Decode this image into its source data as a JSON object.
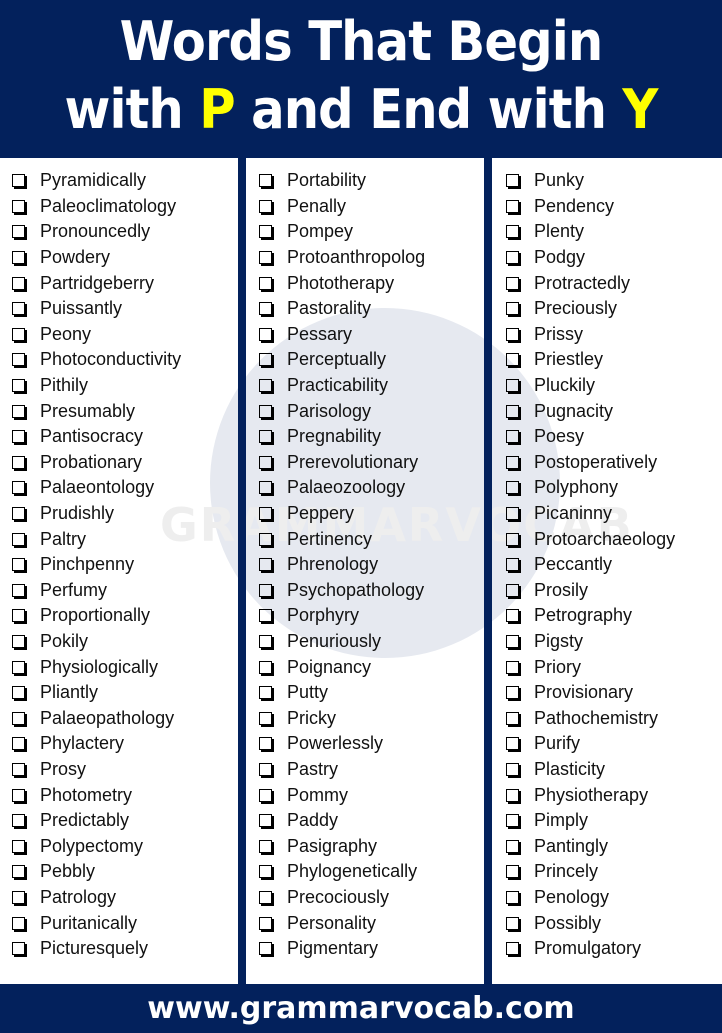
{
  "header": {
    "line1": "Words That Begin",
    "line2_prefix": "with ",
    "line2_letter_start": "P",
    "line2_middle": " and End with ",
    "line2_letter_end": "Y",
    "highlight_color": "#ffff00",
    "background_color": "#03215c"
  },
  "watermark": {
    "text": "GRAMMARVOCAB"
  },
  "columns": [
    {
      "items": [
        "Pyramidically",
        "Paleoclimatology",
        "Pronouncedly",
        "Powdery",
        "Partridgeberry",
        "Puissantly",
        "Peony",
        "Photoconductivity",
        "Pithily",
        "Presumably",
        "Pantisocracy",
        "Probationary",
        "Palaeontology",
        "Prudishly",
        "Paltry",
        "Pinchpenny",
        "Perfumy",
        "Proportionally",
        "Pokily",
        "Physiologically",
        "Pliantly",
        "Palaeopathology",
        "Phylactery",
        "Prosy",
        "Photometry",
        "Predictably",
        "Polypectomy",
        "Pebbly",
        "Patrology",
        "Puritanically",
        "Picturesquely"
      ]
    },
    {
      "items": [
        "Portability",
        "Penally",
        "Pompey",
        "Protoanthropolog",
        "Phototherapy",
        "Pastorality",
        "Pessary",
        "Perceptually",
        "Practicability",
        "Parisology",
        "Pregnability",
        "Prerevolutionary",
        "Palaeozoology",
        "Peppery",
        "Pertinency",
        "Phrenology",
        "Psychopathology",
        "Porphyry",
        "Penuriously",
        "Poignancy",
        "Putty",
        "Pricky",
        "Powerlessly",
        "Pastry",
        "Pommy",
        "Paddy",
        "Pasigraphy",
        "Phylogenetically",
        "Precociously",
        "Personality",
        "Pigmentary"
      ]
    },
    {
      "items": [
        "Punky",
        "Pendency",
        "Plenty",
        "Podgy",
        "Protractedly",
        "Preciously",
        "Prissy",
        "Priestley",
        "Pluckily",
        "Pugnacity",
        "Poesy",
        "Postoperatively",
        "Polyphony",
        "Picaninny",
        "Protoarchaeology",
        "Peccantly",
        "Prosily",
        "Petrography",
        "Pigsty",
        "Priory",
        "Provisionary",
        "Pathochemistry",
        "Purify",
        "Plasticity",
        "Physiotherapy",
        "Pimply",
        "Pantingly",
        "Princely",
        "Penology",
        "Possibly",
        "Promulgatory"
      ]
    }
  ],
  "checkbox_icon": "empty-checkbox-icon",
  "footer": {
    "url": "www.grammarvocab.com"
  }
}
